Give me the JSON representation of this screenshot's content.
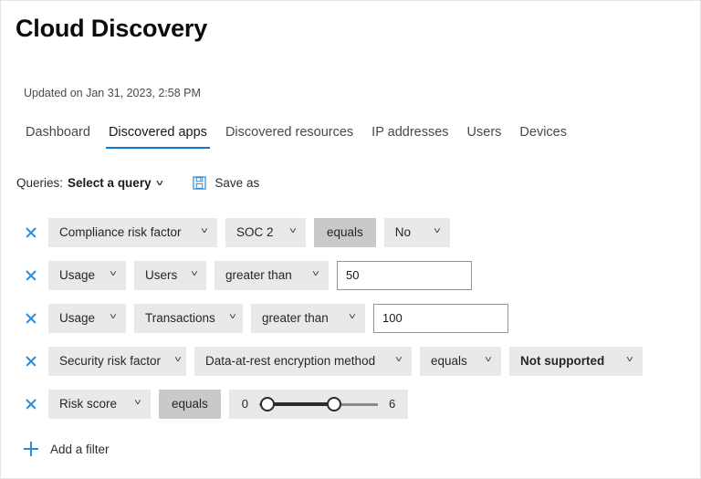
{
  "header": {
    "title": "Cloud Discovery",
    "updated": "Updated on Jan 31, 2023, 2:58 PM"
  },
  "tabs": [
    {
      "label": "Dashboard",
      "active": false
    },
    {
      "label": "Discovered apps",
      "active": true
    },
    {
      "label": "Discovered resources",
      "active": false
    },
    {
      "label": "IP addresses",
      "active": false
    },
    {
      "label": "Users",
      "active": false
    },
    {
      "label": "Devices",
      "active": false
    }
  ],
  "queries": {
    "label": "Queries:",
    "selected": "Select a query",
    "chevron": "chevron-down-icon",
    "save_as_label": "Save as",
    "save_icon": "save-floppy-icon"
  },
  "filters": {
    "rows": [
      {
        "remove_icon": "close-icon",
        "controls": [
          {
            "kind": "dropdown",
            "label": "Compliance risk factor",
            "bold": false
          },
          {
            "kind": "dropdown",
            "label": "SOC 2",
            "bold": false
          },
          {
            "kind": "static",
            "label": "equals"
          },
          {
            "kind": "dropdown",
            "label": "No",
            "bold": false
          }
        ]
      },
      {
        "remove_icon": "close-icon",
        "controls": [
          {
            "kind": "dropdown",
            "label": "Usage",
            "bold": false
          },
          {
            "kind": "dropdown",
            "label": "Users",
            "bold": false
          },
          {
            "kind": "dropdown",
            "label": "greater than",
            "bold": false
          },
          {
            "kind": "textbox",
            "value": "50",
            "placeholder": "",
            "width": 148
          }
        ]
      },
      {
        "remove_icon": "close-icon",
        "controls": [
          {
            "kind": "dropdown",
            "label": "Usage",
            "bold": false
          },
          {
            "kind": "dropdown",
            "label": "Transactions",
            "bold": false
          },
          {
            "kind": "dropdown",
            "label": "greater than",
            "bold": false
          },
          {
            "kind": "textbox",
            "value": "100",
            "placeholder": "",
            "width": 148
          }
        ]
      },
      {
        "remove_icon": "close-icon",
        "controls": [
          {
            "kind": "dropdown",
            "label": "Security risk factor",
            "bold": false
          },
          {
            "kind": "dropdown",
            "label": "Data-at-rest encryption method",
            "bold": false
          },
          {
            "kind": "dropdown",
            "label": "equals",
            "bold": false
          },
          {
            "kind": "dropdown",
            "label": "Not supported",
            "bold": true
          }
        ]
      },
      {
        "remove_icon": "close-icon",
        "controls": [
          {
            "kind": "dropdown",
            "label": "Risk score",
            "bold": false
          },
          {
            "kind": "static",
            "label": "equals"
          },
          {
            "kind": "slider",
            "min_label": "0",
            "max_label": "6",
            "low_value": 0,
            "high_value": 4,
            "range": [
              0,
              6
            ]
          }
        ]
      }
    ],
    "add_filter": {
      "label": "Add a filter",
      "icon": "plus-icon"
    }
  },
  "colors": {
    "accent_blue": "#0f78d4",
    "icon_blue": "#2c8ddd",
    "pill_bg": "#e9e9e9",
    "pill_static_bg": "#c9c9c9"
  }
}
